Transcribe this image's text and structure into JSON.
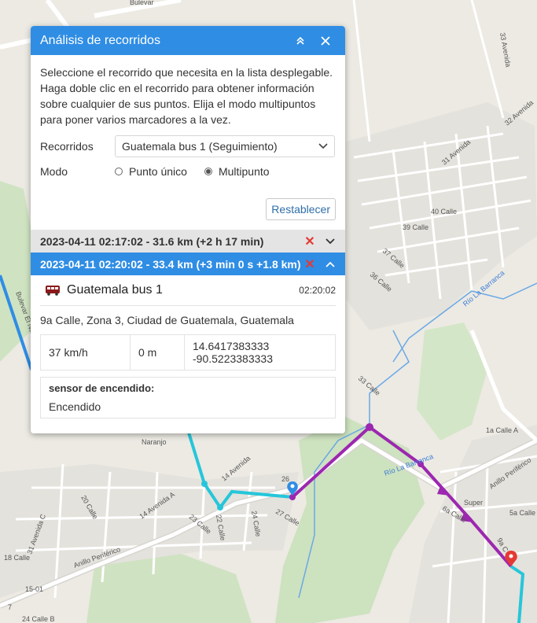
{
  "panel": {
    "title": "Análisis de recorridos",
    "description": "Seleccione el recorrido que necesita en la lista desplegable. Haga doble clic en el recorrido para obtener información sobre cualquier de sus puntos. Elija el modo multipuntos para poner varios marcadores a la vez.",
    "tracks_label": "Recorridos",
    "tracks_value": "Guatemala bus 1 (Seguimiento)",
    "mode_label": "Modo",
    "mode_single": "Punto único",
    "mode_multi": "Multipunto",
    "mode_selected": "Multipunto",
    "reset_label": "Restablecer"
  },
  "tracks": [
    {
      "label": "2023-04-11 02:17:02 - 31.6 km (+2 h 17 min)",
      "active": false,
      "color": "#e4e4e4"
    },
    {
      "label": "2023-04-11 02:20:02 - 33.4 km (+3 min 0 s +1.8 km)",
      "active": true,
      "color": "#2f8de4"
    }
  ],
  "info": {
    "unit_name": "Guatemala bus 1",
    "time": "02:20:02",
    "address": "9a Calle, Zona 3, Ciudad de Guatemala, Guatemala",
    "speed": "37 km/h",
    "altitude": "0 m",
    "lat": "14.6417383333",
    "lon": "-90.5223383333",
    "sensor_title": "sensor de encendido:",
    "sensor_value": "Encendido"
  },
  "map": {
    "labels": {
      "bulevar_top": "Bulevar",
      "avenida_33": "33 Avenida",
      "avenida_32": "32 Avenida",
      "avenida_31": "31 Avenida",
      "calle_40": "40 Calle",
      "calle_39": "39 Calle",
      "calle_37": "37 Calle",
      "calle_36": "36 Calle",
      "calle_33": "33 Calle",
      "rio_barranca_1": "Río La Barranca",
      "rio_barranca_2": "Río La Barranca",
      "calle_1a": "1a Calle A",
      "anillo_periferico_right": "Anillo Periférico",
      "super": "Super",
      "calle_5a": "5a Calle",
      "calle_6a": "6a Calle",
      "calle_9a": "9a C",
      "avenida_14": "14 Avenida",
      "avenida_14a": "14 Avenida A",
      "avenida_20": "20 Calle",
      "calle_23": "23 Calle",
      "calle_22": "22 Calle",
      "calle_24": "24 Calle",
      "calle_27": "27 Calle",
      "anillo_periferico_left": "Anillo Periférico",
      "calle_15": "15-01",
      "avenida_31c": "31 Avenida C",
      "calle_18": "18 Calle",
      "calle_24b": "24 Calle B",
      "naranjo": "Naranjo",
      "bulevar_naranjo": "Bulevar El Naranjo",
      "avenida_7": "7",
      "number_26": "26"
    },
    "route_purple": "#9c27b0",
    "route_cyan": "#26c6da",
    "route_blue": "#2f8de4",
    "marker_red": "#e53935"
  }
}
